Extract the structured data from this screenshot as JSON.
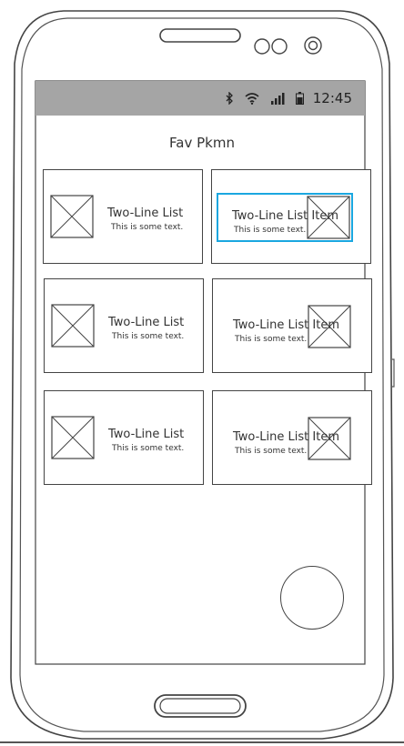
{
  "status_bar": {
    "time": "12:45",
    "icons": [
      "bluetooth-icon",
      "wifi-icon",
      "signal-icon",
      "battery-icon"
    ]
  },
  "screen": {
    "title": "Fav Pkmn"
  },
  "grid": {
    "items": [
      {
        "line1": "Two-Line List",
        "line2": "This is some text."
      },
      {
        "line1": "Two-Line List Item",
        "line2": "This is some text."
      },
      {
        "line1": "Two-Line List",
        "line2": "This is some text."
      },
      {
        "line1": "Two-Line List Item",
        "line2": "This is some text."
      },
      {
        "line1": "Two-Line List",
        "line2": "This is some text."
      },
      {
        "line1": "Two-Line List Item",
        "line2": "This is some text."
      }
    ]
  },
  "colors": {
    "status_bar_bg": "#a5a5a5",
    "selection": "#1aa7e0",
    "outline": "#444444"
  }
}
